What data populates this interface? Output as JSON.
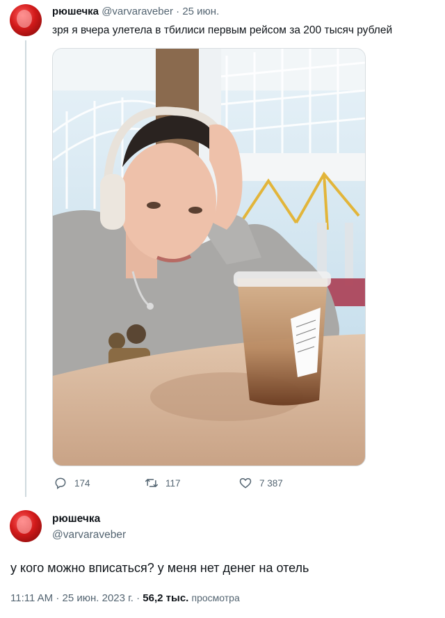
{
  "tweet": {
    "author_name": "рюшечка",
    "author_handle": "@varvaraveber",
    "separator": "·",
    "date": "25 июн.",
    "text": "зря я вчера улетела в тбилиси первым рейсом за 200 тысяч рублей",
    "photo_icon": "photo-selfie-airport",
    "stats": {
      "replies": "174",
      "retweets": "117",
      "likes": "7 387"
    }
  },
  "reply": {
    "author_name": "рюшечка",
    "author_handle": "@varvaraveber",
    "text": "у кого можно вписаться? у меня нет денег на отель",
    "time": "11:11 AM",
    "separator": "·",
    "date": "25 июн. 2023 г.",
    "separator2": "·",
    "views_count": "56,2 тыс.",
    "views_label": "просмотра"
  },
  "colors": {
    "muted": "#536471",
    "text": "#0f1419",
    "thread_line": "#cfd9de"
  }
}
